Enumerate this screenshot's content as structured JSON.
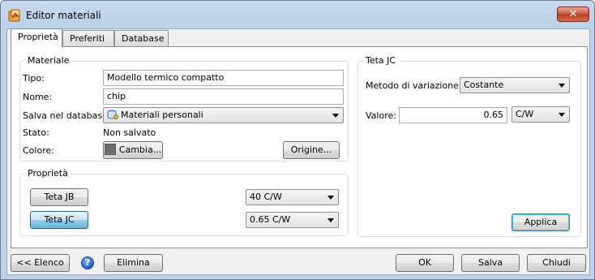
{
  "window": {
    "title": "Editor materiali",
    "close_label": "✕"
  },
  "tabs": [
    {
      "label": "Proprietà"
    },
    {
      "label": "Preferiti"
    },
    {
      "label": "Database"
    }
  ],
  "materiale": {
    "group_title": "Materiale",
    "tipo_label": "Tipo:",
    "tipo_value": "Modello termico compatto",
    "nome_label": "Nome:",
    "nome_value": "chip",
    "salva_label": "Salva nel database:",
    "salva_value": "Materiali personali",
    "stato_label": "Stato:",
    "stato_value": "Non salvato",
    "colore_label": "Colore:",
    "cambia_label": "Cambia...",
    "origine_label": "Origine...",
    "swatch_color": "#6d6d6d"
  },
  "proprieta": {
    "group_title": "Proprietà",
    "rows": [
      {
        "button": "Teta JB",
        "value": "40 C/W"
      },
      {
        "button": "Teta JC",
        "value": "0.65 C/W"
      }
    ]
  },
  "teta_jc": {
    "group_title": "Teta JC",
    "metodo_label": "Metodo di variazione:",
    "metodo_value": "Costante",
    "valore_label": "Valore:",
    "valore_value": "0.65",
    "unit_value": "C/W",
    "applica_label": "Applica"
  },
  "footer": {
    "elenco_label": "<< Elenco",
    "help_glyph": "?",
    "elimina_label": "Elimina",
    "ok_label": "OK",
    "salva_label": "Salva",
    "chiudi_label": "Chiudi"
  }
}
